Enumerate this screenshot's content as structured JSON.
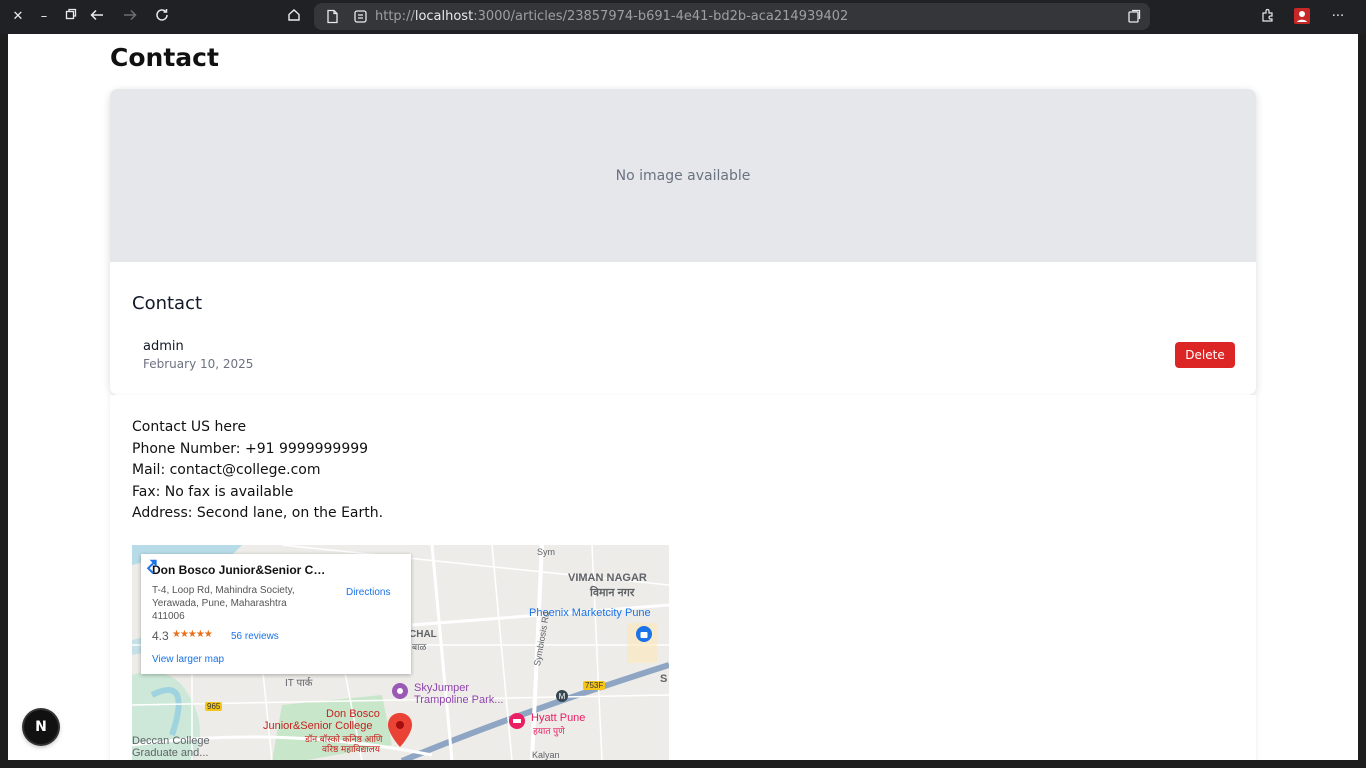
{
  "browser": {
    "url_prefix": "http://",
    "url_host": "localhost",
    "url_path": ":3000/articles/23857974-b691-4e41-bd2b-aca214939402"
  },
  "page": {
    "title": "Contact"
  },
  "article": {
    "placeholder": "No image available",
    "title": "Contact",
    "author": "admin",
    "date": "February 10, 2025",
    "delete_label": "Delete"
  },
  "content": {
    "lines": [
      "Contact US here",
      "Phone Number: +91 9999999999",
      "Mail: contact@college.com",
      "Fax: No fax is available",
      "Address: Second lane, on the Earth."
    ]
  },
  "map": {
    "place_name": "Don Bosco Junior&Senior Coll...",
    "address": "T-4, Loop Rd, Mahindra Society, Yerawada, Pune, Maharashtra 411006",
    "rating": "4.3",
    "reviews": "56 reviews",
    "larger_map": "View larger map",
    "directions": "Directions",
    "labels": {
      "viman_nagar": "VIMAN NAGAR",
      "viman_nagar_hi": "विमान नगर",
      "phoenix": "Phoenix Marketcity Pune",
      "chal": "CHAL",
      "chal_hi": "बाळ",
      "it_park": "IT पार्क",
      "skyjumper1": "SkyJumper",
      "skyjumper2": "Trampoline Park...",
      "symbiosis": "Symbiosis Rd",
      "road_753f": "753F",
      "road_965": "965",
      "don_bosco1": "Don Bosco",
      "don_bosco2": "Junior&Senior College",
      "don_bosco3": "डॉन बॉस्को कनिष्ठ आणि",
      "don_bosco4": "वरिष्ठ महाविद्यालय",
      "hyatt": "Hyatt Pune",
      "hyatt_hi": "हयात पुणे",
      "deccan1": "Deccan College",
      "deccan2": "Graduate and...",
      "kalyani": "Kalyan",
      "s_edge": "S",
      "sym_top": "Sym"
    }
  },
  "next_badge": "N"
}
